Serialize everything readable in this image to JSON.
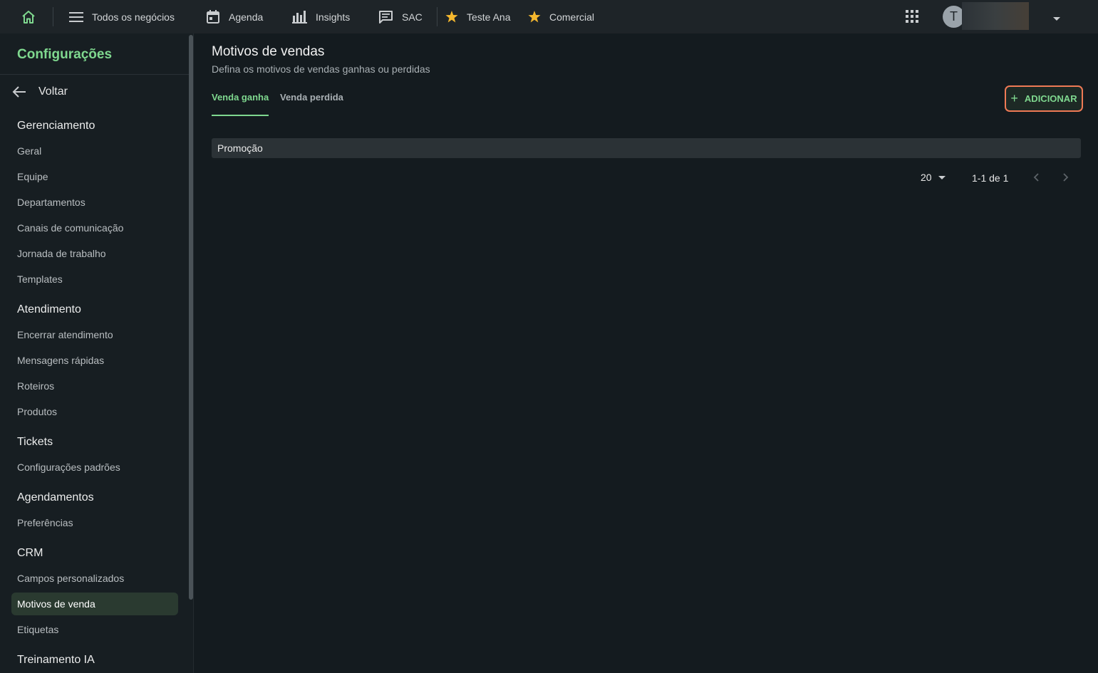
{
  "topbar": {
    "nav": [
      {
        "label": "Todos os negócios",
        "icon": "menu-icon"
      },
      {
        "label": "Agenda",
        "icon": "calendar-icon"
      },
      {
        "label": "Insights",
        "icon": "bar-chart-icon"
      },
      {
        "label": "SAC",
        "icon": "chat-icon"
      },
      {
        "label": "Teste Ana",
        "icon": "star-icon"
      },
      {
        "label": "Comercial",
        "icon": "star-icon"
      }
    ],
    "avatar_initial": "T",
    "accent_star": "#f5b82e"
  },
  "sidebar": {
    "title": "Configurações",
    "back_label": "Voltar",
    "sections": [
      {
        "title": "Gerenciamento",
        "items": [
          "Geral",
          "Equipe",
          "Departamentos",
          "Canais de comunicação",
          "Jornada de trabalho",
          "Templates"
        ]
      },
      {
        "title": "Atendimento",
        "items": [
          "Encerrar atendimento",
          "Mensagens rápidas",
          "Roteiros",
          "Produtos"
        ]
      },
      {
        "title": "Tickets",
        "items": [
          "Configurações padrões"
        ]
      },
      {
        "title": "Agendamentos",
        "items": [
          "Preferências"
        ]
      },
      {
        "title": "CRM",
        "items": [
          "Campos personalizados",
          "Motivos de venda",
          "Etiquetas"
        ]
      },
      {
        "title": "Treinamento IA",
        "items": []
      }
    ],
    "active_item": "Motivos de venda"
  },
  "main": {
    "title": "Motivos de vendas",
    "subtitle": "Defina os motivos de vendas ganhas ou perdidas",
    "tabs": [
      {
        "label": "Venda ganha",
        "active": true
      },
      {
        "label": "Venda perdida",
        "active": false
      }
    ],
    "add_button": "ADICIONAR",
    "rows": [
      "Promoção"
    ],
    "pagination": {
      "per_page": "20",
      "range": "1-1 de 1"
    }
  },
  "colors": {
    "accent_green": "#7fd88f",
    "highlight_orange": "#ef7a55",
    "background": "#141b1f"
  }
}
